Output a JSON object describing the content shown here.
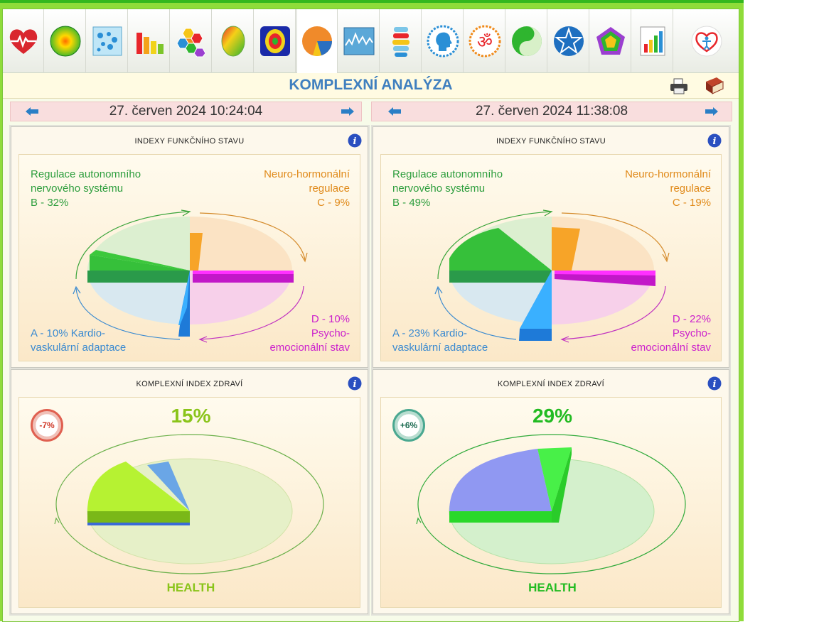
{
  "header": {
    "title": "KOMPLEXNÍ ANALÝZA",
    "toolbar_icons": [
      "heart-ecg-icon",
      "green-sphere-icon",
      "blue-dots-icon",
      "bar-chart-icon",
      "hexagon-grid-icon",
      "brain-map-icon",
      "body-scan-icon",
      "pie-chart-icon",
      "wave-chart-icon",
      "spine-icon",
      "head-profile-icon",
      "om-symbol-icon",
      "yin-yang-icon",
      "star-icon",
      "pentagon-icon",
      "report-chart-icon",
      "human-heart-logo-icon"
    ]
  },
  "sessions": [
    {
      "date": "27. červen 2024 10:24:04",
      "indices_title": "INDEXY FUNKČNÍHO STAVU",
      "health_title": "KOMPLEXNÍ INDEX ZDRAVÍ",
      "label_b": [
        "Regulace autonomního",
        "nervového systému",
        "B - 32%"
      ],
      "label_c": [
        "Neuro-hormonální",
        "regulace",
        "C - 9%"
      ],
      "label_a": [
        "A - 10% Kardio-",
        "vaskulární adaptace"
      ],
      "label_d": [
        "D - 10%",
        "Psycho-",
        "emocionální stav"
      ],
      "health_pct": "15%",
      "health_badge": "-7%",
      "health_word": "HEALTH"
    },
    {
      "date": "27. červen 2024 11:38:08",
      "indices_title": "INDEXY FUNKČNÍHO STAVU",
      "health_title": "KOMPLEXNÍ INDEX ZDRAVÍ",
      "label_b": [
        "Regulace autonomního",
        "nervového systému",
        "B - 49%"
      ],
      "label_c": [
        "Neuro-hormonální",
        "regulace",
        "C - 19%"
      ],
      "label_a": [
        "A - 23% Kardio-",
        "vaskulární adaptace"
      ],
      "label_d": [
        "D - 22%",
        "Psycho-",
        "emocionální stav"
      ],
      "health_pct": "29%",
      "health_badge": "+6%",
      "health_word": "HEALTH"
    }
  ],
  "colors": {
    "accent_title": "#3f7fbf",
    "regulation_green": "#2e9e3e",
    "neuro_orange": "#e08a1a",
    "cardio_blue": "#3a8ad0",
    "psycho_magenta": "#cc22cc",
    "health_green": "#22bb22",
    "badge_red": "#e06050",
    "badge_teal": "#4aa890"
  }
}
